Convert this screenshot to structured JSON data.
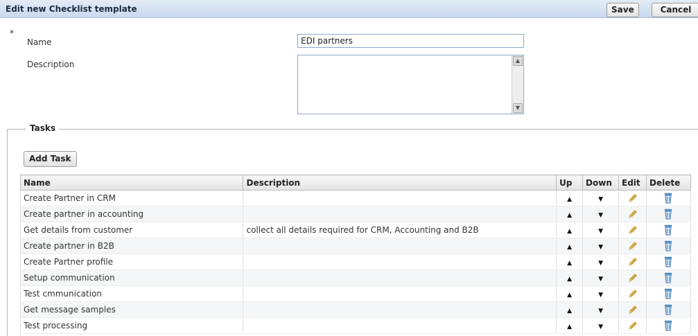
{
  "header": {
    "title": "Edit new Checklist template",
    "save_label": "Save",
    "cancel_label": "Cancel"
  },
  "form": {
    "required_mark": "*",
    "name_label": "Name",
    "name_value": "EDI partners",
    "description_label": "Description",
    "description_value": ""
  },
  "tasks": {
    "legend": "Tasks",
    "add_task_label": "Add Task",
    "columns": [
      "Name",
      "Description",
      "Up",
      "Down",
      "Edit",
      "Delete"
    ],
    "rows": [
      {
        "name": "Create Partner in CRM",
        "description": ""
      },
      {
        "name": "Create partner in accounting",
        "description": ""
      },
      {
        "name": "Get details from customer",
        "description": "collect all details required for CRM, Accounting and B2B"
      },
      {
        "name": "Create partner in B2B",
        "description": ""
      },
      {
        "name": "Create Partner profile",
        "description": ""
      },
      {
        "name": "Setup communication",
        "description": ""
      },
      {
        "name": "Test cmmunication",
        "description": ""
      },
      {
        "name": "Get message samples",
        "description": ""
      },
      {
        "name": "Test processing",
        "description": ""
      }
    ],
    "icons": {
      "up": "arrow-up-icon",
      "down": "arrow-down-icon",
      "edit": "pencil-icon",
      "delete": "trash-icon"
    }
  },
  "colors": {
    "header_bg": "#c9d9ee",
    "input_border": "#8fa7c8",
    "pencil": "#e0a82e",
    "trash": "#3f86c6"
  }
}
